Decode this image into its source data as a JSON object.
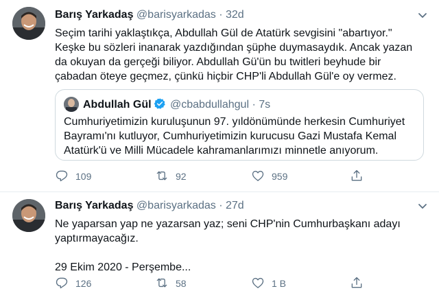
{
  "tweets": [
    {
      "author_name": "Barış Yarkadaş",
      "handle": "@barisyarkadas",
      "separator": "·",
      "time": "32d",
      "text": "Seçim tarihi yaklaştıkça, Abdullah Gül de Atatürk sevgisini \"abartıyor.\"\nKeşke bu sözleri inanarak yazdığından şüphe duymasaydık. Ancak yazan\nda okuyan da gerçeği biliyor. Abdullah Gü'ün bu twitleri beyhude bir\nçabadan öteye geçmez, çünkü hiçbir CHP'li Abdullah Gül'e oy vermez.",
      "quoted": {
        "author_name": "Abdullah Gül",
        "handle": "@cbabdullahgul",
        "separator": "·",
        "time": "7s",
        "text": "Cumhuriyetimizin kuruluşunun 97. yıldönümünde herkesin Cumhuriyet\nBayramı'nı kutluyor, Cumhuriyetimizin kurucusu Gazi Mustafa Kemal\nAtatürk'ü ve Milli Mücadele kahramanlarımızı minnetle anıyorum."
      },
      "replies": "109",
      "retweets": "92",
      "likes": "959"
    },
    {
      "author_name": "Barış Yarkadaş",
      "handle": "@barisyarkadas",
      "separator": "·",
      "time": "27d",
      "text": "Ne yaparsan yap ne yazarsan yaz; seni CHP'nin Cumhurbaşkanı adayı\nyaptırmayacağız.\n\n29 Ekim 2020 - Perşembe...",
      "replies": "126",
      "retweets": "58",
      "likes": "1 B"
    }
  ],
  "icons": {
    "caret": "chevron-down-icon",
    "reply": "reply-icon",
    "retweet": "retweet-icon",
    "like": "heart-icon",
    "share": "share-icon",
    "verified": "verified-badge-icon"
  },
  "colors": {
    "secondary_text": "#5b7083",
    "verified_blue": "#1da1f2",
    "border": "#cfd9de"
  }
}
